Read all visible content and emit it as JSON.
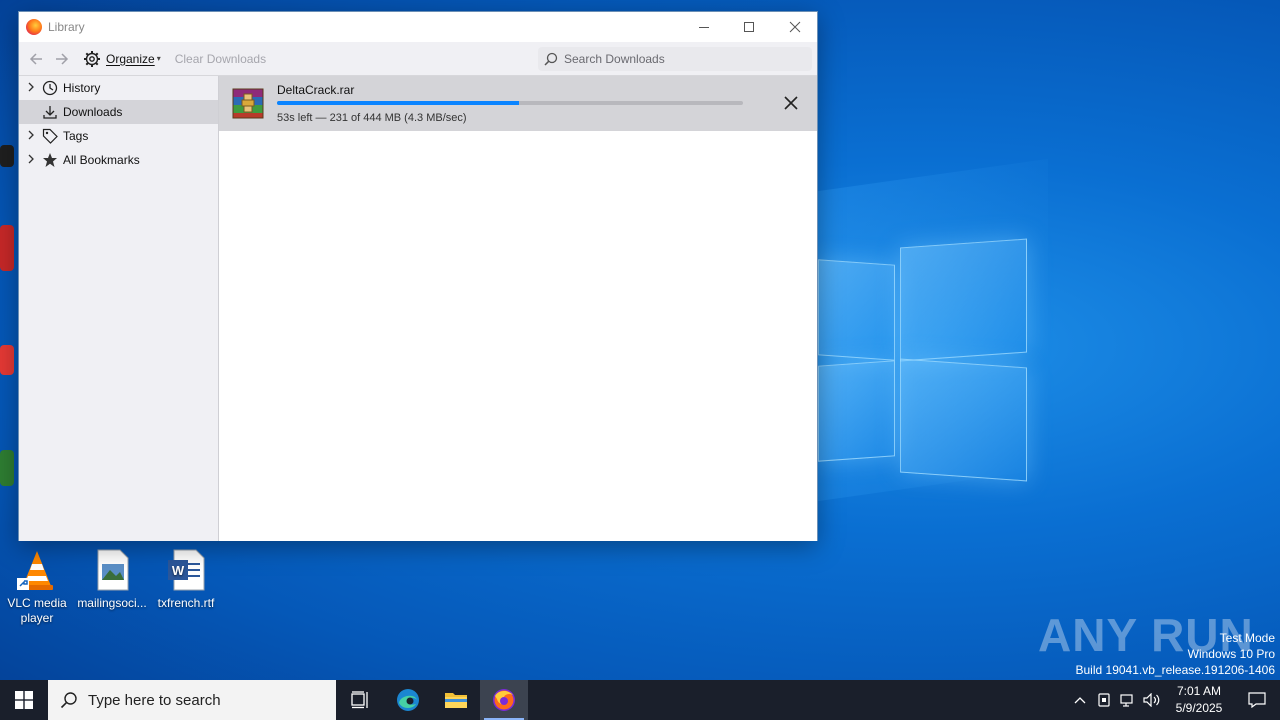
{
  "window": {
    "title": "Library",
    "controls": {
      "minimize": "—",
      "maximize": "☐",
      "close": "✕"
    }
  },
  "toolbar": {
    "organize_label": "Organize",
    "clear_label": "Clear Downloads",
    "search_placeholder": "Search Downloads"
  },
  "sidebar": {
    "items": [
      {
        "label": "History",
        "icon": "clock-icon",
        "expandable": true
      },
      {
        "label": "Downloads",
        "icon": "download-icon",
        "expandable": false,
        "selected": true
      },
      {
        "label": "Tags",
        "icon": "tag-icon",
        "expandable": true
      },
      {
        "label": "All Bookmarks",
        "icon": "star-icon",
        "expandable": true
      }
    ]
  },
  "downloads": [
    {
      "filename": "DeltaCrack.rar",
      "status": "53s left — 231 of 444 MB (4.3 MB/sec)",
      "progress": 0.52,
      "icon": "winrar-archive-icon"
    }
  ],
  "desktop": {
    "icons": [
      {
        "label": "VLC media player",
        "icon": "vlc-icon"
      },
      {
        "label": "mailingsoci...",
        "icon": "image-file-icon"
      },
      {
        "label": "txfrench.rtf",
        "icon": "word-document-icon"
      }
    ]
  },
  "watermark": {
    "brand": "ANY RUN",
    "lines": [
      "Test Mode",
      "Windows 10 Pro",
      "Build 19041.vb_release.191206-1406"
    ]
  },
  "taskbar": {
    "search_placeholder": "Type here to search",
    "clock_time": "7:01 AM",
    "clock_date": "5/9/2025"
  },
  "colors": {
    "accent": "#0a84ff",
    "taskbar": "#1a1f2b",
    "selected_row": "#d4d4d9"
  }
}
